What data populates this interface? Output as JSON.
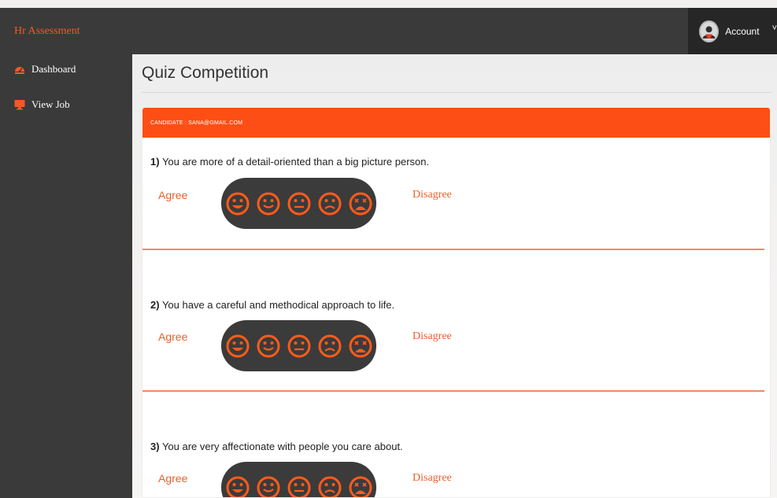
{
  "app": {
    "title": "Hr Assessment"
  },
  "account": {
    "label": "Account",
    "chevron": "˅"
  },
  "sidebar": {
    "items": [
      {
        "label": "Dashboard",
        "icon": "dashboard-icon"
      },
      {
        "label": "View Job",
        "icon": "monitor-icon"
      }
    ]
  },
  "page": {
    "title": "Quiz Competition"
  },
  "card": {
    "header": "CANDIDATE : SANA@GMAIL.COM"
  },
  "scale": {
    "agree": "Agree",
    "disagree": "Disagree"
  },
  "questions": [
    {
      "num": "1)",
      "text": "You are more of a detail-oriented than a big picture person."
    },
    {
      "num": "2)",
      "text": "You have a careful and methodical approach to life."
    },
    {
      "num": "3)",
      "text": "You are very affectionate with people you care about."
    }
  ],
  "colors": {
    "accent": "#fd4f15",
    "dark": "#3a3a3a",
    "darker": "#262626"
  }
}
